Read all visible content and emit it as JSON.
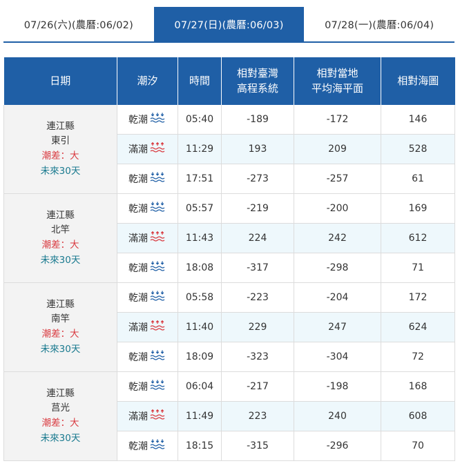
{
  "tabs": [
    {
      "label": "07/26(六)(農曆:06/02)",
      "active": false
    },
    {
      "label": "07/27(日)(農曆:06/03)",
      "active": true
    },
    {
      "label": "07/28(一)(農曆:06/04)",
      "active": false
    }
  ],
  "table": {
    "headers": {
      "date": "日期",
      "tide": "潮汐",
      "time": "時間",
      "twvd_line1": "相對臺灣",
      "twvd_line2": "高程系統",
      "msl_line1": "相對當地",
      "msl_line2": "平均海平面",
      "chart": "相對海圖"
    },
    "stations": [
      {
        "county": "連江縣",
        "name": "東引",
        "range": "潮差：大",
        "future": "未來30天",
        "rows": [
          {
            "tide": "乾潮",
            "type": "low",
            "time": "05:40",
            "twvd": "-189",
            "msl": "-172",
            "chart": "146"
          },
          {
            "tide": "滿潮",
            "type": "high",
            "time": "11:29",
            "twvd": "193",
            "msl": "209",
            "chart": "528"
          },
          {
            "tide": "乾潮",
            "type": "low",
            "time": "17:51",
            "twvd": "-273",
            "msl": "-257",
            "chart": "61"
          }
        ]
      },
      {
        "county": "連江縣",
        "name": "北竿",
        "range": "潮差：大",
        "future": "未來30天",
        "rows": [
          {
            "tide": "乾潮",
            "type": "low",
            "time": "05:57",
            "twvd": "-219",
            "msl": "-200",
            "chart": "169"
          },
          {
            "tide": "滿潮",
            "type": "high",
            "time": "11:43",
            "twvd": "224",
            "msl": "242",
            "chart": "612"
          },
          {
            "tide": "乾潮",
            "type": "low",
            "time": "18:08",
            "twvd": "-317",
            "msl": "-298",
            "chart": "71"
          }
        ]
      },
      {
        "county": "連江縣",
        "name": "南竿",
        "range": "潮差：大",
        "future": "未來30天",
        "rows": [
          {
            "tide": "乾潮",
            "type": "low",
            "time": "05:58",
            "twvd": "-223",
            "msl": "-204",
            "chart": "172"
          },
          {
            "tide": "滿潮",
            "type": "high",
            "time": "11:40",
            "twvd": "229",
            "msl": "247",
            "chart": "624"
          },
          {
            "tide": "乾潮",
            "type": "low",
            "time": "18:09",
            "twvd": "-323",
            "msl": "-304",
            "chart": "72"
          }
        ]
      },
      {
        "county": "連江縣",
        "name": "莒光",
        "range": "潮差：大",
        "future": "未來30天",
        "rows": [
          {
            "tide": "乾潮",
            "type": "low",
            "time": "06:04",
            "twvd": "-217",
            "msl": "-198",
            "chart": "168"
          },
          {
            "tide": "滿潮",
            "type": "high",
            "time": "11:49",
            "twvd": "223",
            "msl": "240",
            "chart": "608"
          },
          {
            "tide": "乾潮",
            "type": "low",
            "time": "18:15",
            "twvd": "-315",
            "msl": "-296",
            "chart": "70"
          }
        ]
      }
    ]
  },
  "colors": {
    "accent": "#1f5fa6",
    "high_tide_icon": "#d9393f",
    "low_tide_icon": "#1f5fa6",
    "tide_range": "#d9393f",
    "future_link": "#1a7a8f"
  },
  "icons": {
    "low": "low-tide-icon",
    "high": "high-tide-icon"
  }
}
